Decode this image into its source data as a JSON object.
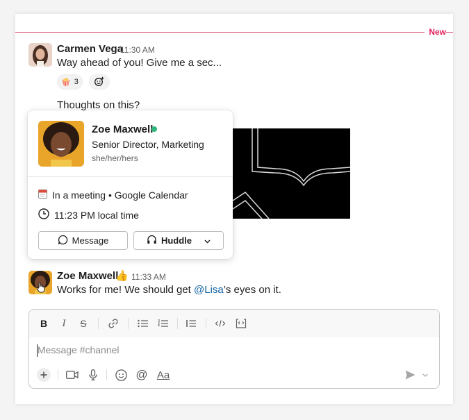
{
  "divider": {
    "label": "New"
  },
  "messages": [
    {
      "author": "Carmen Vega",
      "time": "11:30 AM",
      "lines": [
        "Way ahead of you! Give me a sec...",
        "Thoughts on this?"
      ],
      "reactions": [
        {
          "emoji": "🍿",
          "count": "3"
        }
      ],
      "add_reaction_icon": "add-emoji-icon"
    },
    {
      "author": "Zoe Maxwell",
      "author_emoji": "👍",
      "time": "11:33 AM",
      "text_before": "Works for me! We should get ",
      "mention": "@Lisa",
      "text_after": "’s eyes on it."
    }
  ],
  "profile_card": {
    "name": "Zoe Maxwell",
    "presence": "active",
    "title": "Senior Director, Marketing",
    "pronouns": "she/her/hers",
    "status_emoji": "🗓️",
    "status": "In a meeting • Google Calendar",
    "local_time": "11:23 PM local time",
    "buttons": {
      "message": "Message",
      "huddle": "Huddle"
    }
  },
  "composer": {
    "placeholder": "Message #channel",
    "format_tools": [
      "bold",
      "italic",
      "strikethrough",
      "link",
      "bulleted-list",
      "numbered-list",
      "blockquote",
      "code",
      "code-block"
    ],
    "bottom_tools": [
      "add",
      "video",
      "microphone",
      "emoji",
      "mention",
      "formatting"
    ],
    "formatting_label": "Aa"
  },
  "colors": {
    "new_divider": "#e01e5a",
    "mention": "#1264a3",
    "presence": "#2eb67d"
  }
}
